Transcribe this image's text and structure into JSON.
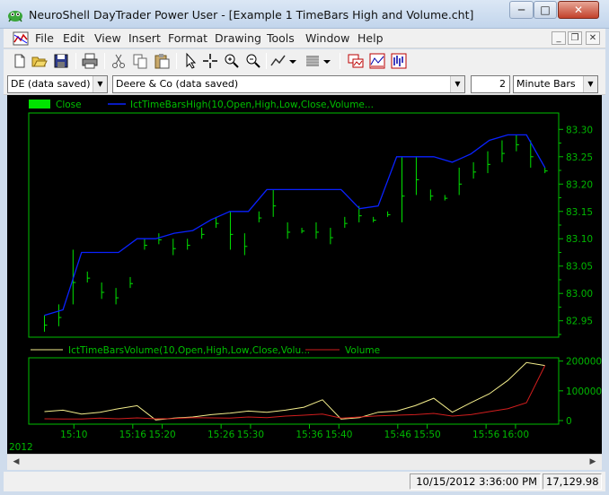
{
  "window": {
    "title": "NeuroShell DayTrader Power User - [Example 1 TimeBars High and Volume.cht]",
    "minimize_label": "─",
    "maximize_label": "□",
    "close_label": "✕"
  },
  "menu": {
    "items": [
      "File",
      "Edit",
      "View",
      "Insert",
      "Format",
      "Drawing",
      "Tools",
      "Window",
      "Help"
    ],
    "mdi_minimize": "_",
    "mdi_restore": "❐",
    "mdi_close": "✕"
  },
  "toolbar": {
    "icons": [
      "new-icon",
      "open-icon",
      "save-icon",
      "print-icon",
      "cut-icon",
      "copy-icon",
      "paste-icon",
      "pointer-icon",
      "crosshair-icon",
      "zoom-in-icon",
      "zoom-out-icon",
      "line-tool-icon",
      "pattern-tool-icon",
      "chart-window-icon",
      "chart-a-icon",
      "chart-b-icon"
    ]
  },
  "selectors": {
    "symbol_value": "DE (data saved)",
    "security_value": "Deere & Co (data saved)",
    "interval_value": "2",
    "bar_type_value": "Minute Bars"
  },
  "colors": {
    "chart_bg": "#000000",
    "price_bars": "#00e400",
    "high_line": "#0a22ff",
    "indicator_volume": "#f4ee8c",
    "volume": "#d21e1e",
    "frame": "#00c000",
    "labels": "#00b800"
  },
  "chart_data": [
    {
      "type": "line",
      "panel": "price",
      "legend_placement": "top-left",
      "legend": [
        "Close",
        "IctTimeBarsHigh(10,Open,High,Low,Close,Volume..."
      ],
      "ylim": [
        82.92,
        83.33
      ],
      "yticks": [
        "83.30",
        "83.25",
        "83.20",
        "83.15",
        "83.10",
        "83.05",
        "83.00",
        "82.95"
      ],
      "ytick_values": [
        83.3,
        83.25,
        83.2,
        83.15,
        83.1,
        83.05,
        83.0,
        82.95
      ],
      "bar_count": 54,
      "bars_high": [
        82.96,
        82.98,
        83.08,
        83.04,
        83.02,
        83.01,
        83.03,
        83.1,
        83.11,
        83.1,
        83.1,
        83.12,
        83.14,
        83.15,
        83.11,
        83.15,
        83.19,
        83.13,
        83.12,
        83.13,
        83.12,
        83.14,
        83.16,
        83.14,
        83.15,
        83.25,
        83.25,
        83.19,
        83.18,
        83.23,
        83.24,
        83.26,
        83.28,
        83.29,
        83.28,
        83.23
      ],
      "bars_low": [
        82.93,
        82.94,
        82.98,
        83.02,
        82.99,
        82.98,
        83.01,
        83.08,
        83.09,
        83.07,
        83.08,
        83.1,
        83.12,
        83.08,
        83.07,
        83.13,
        83.14,
        83.1,
        83.11,
        83.1,
        83.09,
        83.12,
        83.13,
        83.13,
        83.14,
        83.13,
        83.18,
        83.17,
        83.17,
        83.18,
        83.21,
        83.22,
        83.24,
        83.26,
        83.23,
        83.22
      ],
      "high_line": [
        82.96,
        82.97,
        83.075,
        83.075,
        83.075,
        83.1,
        83.1,
        83.11,
        83.115,
        83.135,
        83.15,
        83.15,
        83.19,
        83.19,
        83.19,
        83.19,
        83.19,
        83.155,
        83.16,
        83.25,
        83.25,
        83.25,
        83.24,
        83.255,
        83.28,
        83.29,
        83.29,
        83.23
      ]
    },
    {
      "type": "line",
      "panel": "volume",
      "legend_placement": "top-left",
      "legend": [
        "IctTimeBarsVolume(10,Open,High,Low,Close,Volu...",
        "Volume"
      ],
      "ylim": [
        0,
        205000
      ],
      "yticks": [
        "200000",
        "100000",
        "0"
      ],
      "ytick_values": [
        200000,
        100000,
        0
      ],
      "series": [
        {
          "name": "IctTimeBarsVolume(10,Open,High,Low,Close,Volu...",
          "values": [
            30000,
            35000,
            22000,
            28000,
            40000,
            50000,
            2000,
            8000,
            12000,
            20000,
            25000,
            32000,
            28000,
            35000,
            45000,
            70000,
            5000,
            10000,
            28000,
            32000,
            50000,
            75000,
            28000,
            60000,
            90000,
            135000,
            195000,
            185000
          ]
        },
        {
          "name": "Volume",
          "values": [
            6000,
            5000,
            5000,
            8000,
            6000,
            9000,
            6000,
            7000,
            10000,
            9000,
            8000,
            12000,
            10000,
            15000,
            18000,
            22000,
            8000,
            12000,
            16000,
            18000,
            20000,
            24000,
            15000,
            20000,
            30000,
            40000,
            60000,
            185000
          ]
        }
      ]
    }
  ],
  "xaxis": {
    "ticks": [
      "15:10",
      "15:16",
      "15:20",
      "15:26",
      "15:30",
      "15:36",
      "15:40",
      "15:46",
      "15:50",
      "15:56",
      "16:00"
    ],
    "tick_slots": [
      4,
      10,
      13,
      19,
      22,
      28,
      31,
      37,
      40,
      46,
      49
    ],
    "year_label": "2012"
  },
  "status": {
    "datetime": "10/15/2012 3:36:00 PM",
    "value": "17,129.98"
  }
}
